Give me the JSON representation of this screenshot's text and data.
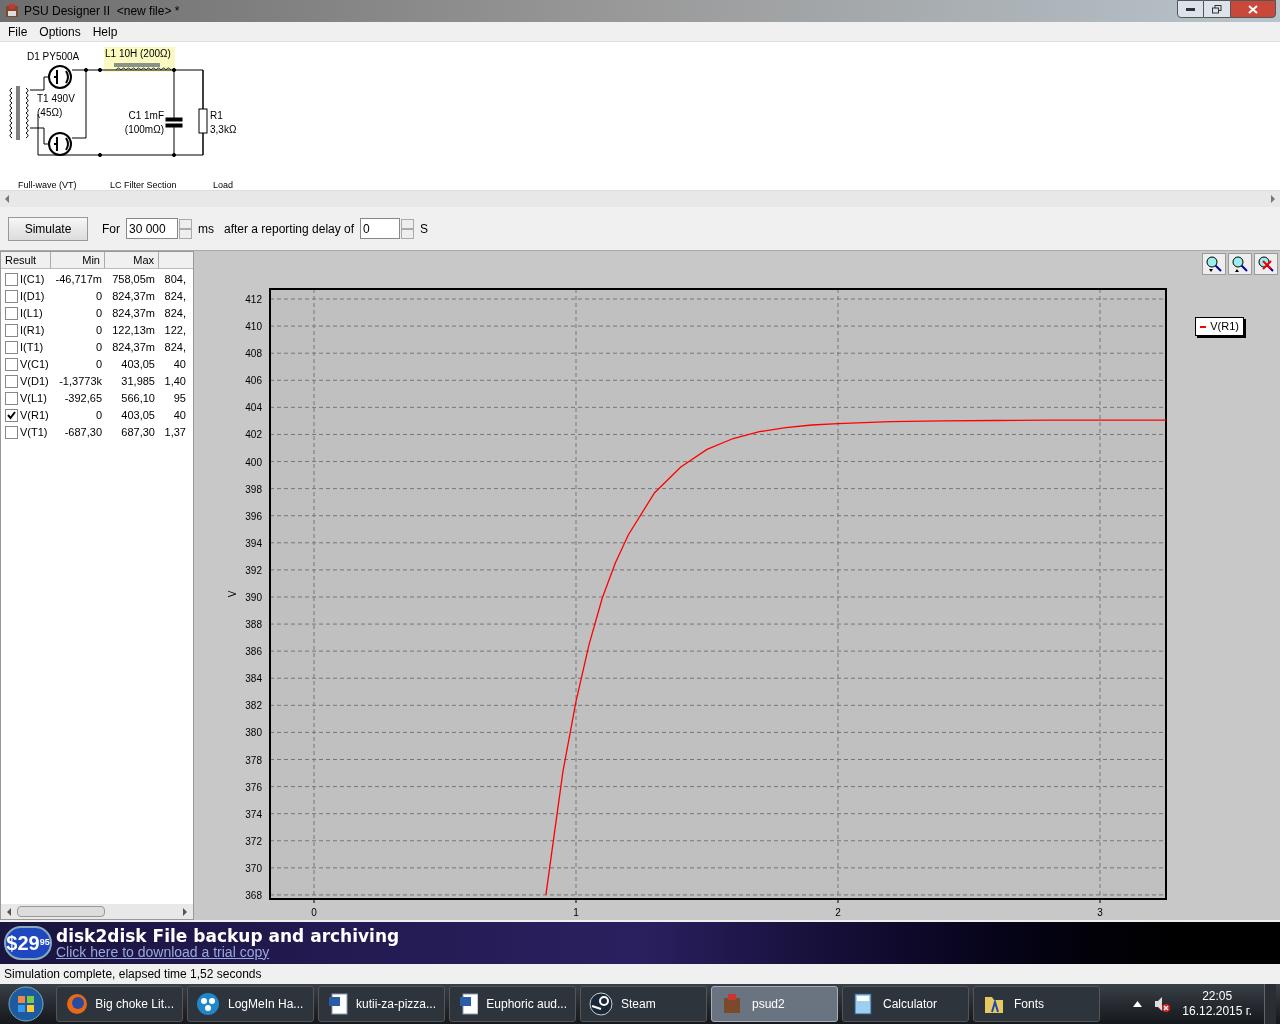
{
  "window": {
    "title": "PSU Designer II  <new file> *"
  },
  "menu": [
    "File",
    "Options",
    "Help"
  ],
  "schematic": {
    "sections": [
      "Full-wave (VT)",
      "LC Filter Section",
      "Load"
    ],
    "components": [
      {
        "kind": "diode",
        "label": "D1 PY500A",
        "selected": false
      },
      {
        "kind": "transformer",
        "label": "T1 490V",
        "detail": "(45Ω)",
        "selected": false
      },
      {
        "kind": "inductor",
        "label": "L1 10H (200Ω)",
        "selected": true
      },
      {
        "kind": "capacitor",
        "label": "C1 1mF",
        "detail": "(100mΩ)",
        "selected": false
      },
      {
        "kind": "resistor",
        "label": "R1",
        "detail": "3,3kΩ",
        "selected": false
      }
    ]
  },
  "toolbar": {
    "simulate": "Simulate",
    "for_label": "For",
    "duration": "30 000",
    "duration_unit": "ms",
    "delay_label": "after a reporting delay of",
    "delay": "0",
    "delay_unit": "S"
  },
  "results": {
    "columns": [
      "Result",
      "Min",
      "Max"
    ],
    "rows": [
      {
        "name": "I(C1)",
        "min": "-46,717m",
        "max": "758,05m",
        "column_4": "804,",
        "checked": false
      },
      {
        "name": "I(D1)",
        "min": "0",
        "max": "824,37m",
        "column_4": "824,",
        "checked": false
      },
      {
        "name": "I(L1)",
        "min": "0",
        "max": "824,37m",
        "column_4": "824,",
        "checked": false
      },
      {
        "name": "I(R1)",
        "min": "0",
        "max": "122,13m",
        "column_4": "122,",
        "checked": false
      },
      {
        "name": "I(T1)",
        "min": "0",
        "max": "824,37m",
        "column_4": "824,",
        "checked": false
      },
      {
        "name": "V(C1)",
        "min": "0",
        "max": "403,05",
        "column_4": "40",
        "checked": false
      },
      {
        "name": "V(D1)",
        "min": "-1,3773k",
        "max": "31,985",
        "column_4": "1,40",
        "checked": false
      },
      {
        "name": "V(L1)",
        "min": "-392,65",
        "max": "566,10",
        "column_4": "95",
        "checked": false
      },
      {
        "name": "V(R1)",
        "min": "0",
        "max": "403,05",
        "column_4": "40",
        "checked": true
      },
      {
        "name": "V(T1)",
        "min": "-687,30",
        "max": "687,30",
        "column_4": "1,37",
        "checked": false
      }
    ]
  },
  "chart": {
    "chart_data": {
      "type": "line",
      "grid": true,
      "ylabel": "V",
      "xlim": [
        -0.168,
        3.252
      ],
      "ylim": [
        367.7,
        412.74
      ],
      "xticks": [
        0,
        1,
        2,
        3
      ],
      "yticks": [
        368,
        370,
        372,
        374,
        376,
        378,
        380,
        382,
        384,
        386,
        388,
        390,
        392,
        394,
        396,
        398,
        400,
        402,
        404,
        406,
        408,
        410,
        412
      ],
      "x": [
        0.885,
        0.95,
        1.0,
        1.05,
        1.1,
        1.15,
        1.2,
        1.3,
        1.4,
        1.5,
        1.6,
        1.7,
        1.8,
        1.9,
        2.0,
        2.2,
        2.4,
        2.6,
        2.8,
        3.0,
        3.252
      ],
      "series": [
        {
          "name": "V(R1)",
          "color": "#ff0000",
          "values": [
            368.0,
            377.1,
            382.3,
            386.5,
            389.9,
            392.5,
            394.6,
            397.7,
            399.6,
            400.9,
            401.7,
            402.2,
            402.5,
            402.7,
            402.8,
            402.95,
            403.0,
            403.03,
            403.05,
            403.05,
            403.05
          ]
        }
      ]
    }
  },
  "ad": {
    "price": "$29",
    "price_cents": "95",
    "headline": "disk2disk File backup and archiving",
    "link": "Click here to download a trial copy"
  },
  "status_bar": "Simulation complete, elapsed time 1,52 seconds",
  "taskbar": {
    "items": [
      {
        "kind": "browser",
        "label": "Big choke Lit...",
        "selected": false
      },
      {
        "kind": "remote",
        "label": "LogMeIn Ha...",
        "selected": false
      },
      {
        "kind": "document",
        "label": "kutii-za-pizza...",
        "selected": false
      },
      {
        "kind": "document",
        "label": "Euphoric aud...",
        "selected": false
      },
      {
        "kind": "steam",
        "label": "Steam",
        "selected": false
      },
      {
        "kind": "app",
        "label": "psud2",
        "selected": true
      },
      {
        "kind": "calculator",
        "label": "Calculator",
        "selected": false
      },
      {
        "kind": "folder",
        "label": "Fonts",
        "selected": false
      }
    ],
    "time": "22:05",
    "date": "16.12.2015 г."
  }
}
